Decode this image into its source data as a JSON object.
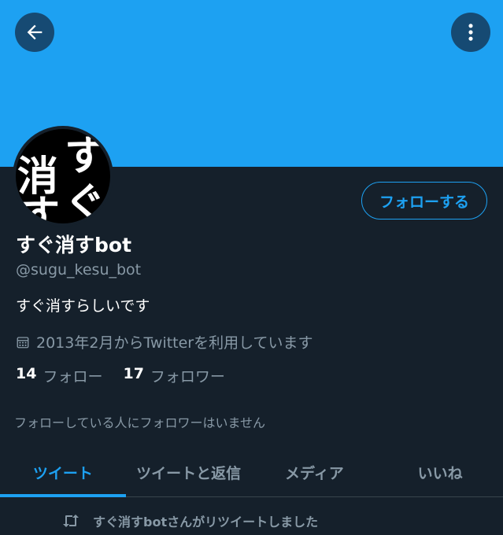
{
  "header": {
    "back_icon": "arrow-left-icon",
    "more_icon": "more-vertical-icon",
    "banner_color": "#1da1f2"
  },
  "avatar": {
    "chars": [
      "す",
      "消",
      "ぐ",
      "す"
    ]
  },
  "profile": {
    "follow_button_label": "フォローする",
    "display_name": "すぐ消すbot",
    "handle": "@sugu_kesu_bot",
    "bio": "すぐ消すらしいです",
    "joined": "2013年2月からTwitterを利用しています",
    "following_count": "14",
    "following_label": "フォロー",
    "followers_count": "17",
    "followers_label": "フォロワー",
    "mutual_note": "フォローしている人にフォロワーはいません"
  },
  "tabs": [
    {
      "label": "ツイート",
      "active": true
    },
    {
      "label": "ツイートと返信",
      "active": false
    },
    {
      "label": "メディア",
      "active": false
    },
    {
      "label": "いいね",
      "active": false
    }
  ],
  "timeline": {
    "retweet_note": "すぐ消すbotさんがリツイートしました"
  },
  "colors": {
    "accent": "#1da1f2",
    "background": "#15202b",
    "secondary_text": "#8899a6"
  }
}
